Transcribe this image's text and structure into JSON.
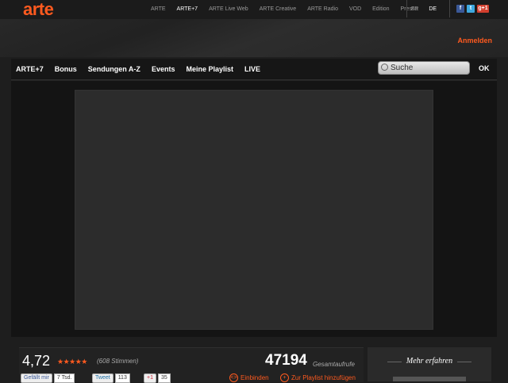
{
  "brand": {
    "logo": "arte"
  },
  "topnav": [
    "ARTE",
    "ARTE+7",
    "ARTE Live Web",
    "ARTE Creative",
    "ARTE Radio",
    "VOD",
    "Edition",
    "Presse"
  ],
  "topnav_active": "ARTE+7",
  "lang": {
    "fr": "FR",
    "de": "DE"
  },
  "social": {
    "facebook": "f",
    "twitter": "t",
    "google": "g+1"
  },
  "login": "Anmelden",
  "mainnav": [
    "ARTE+7",
    "Bonus",
    "Sendungen A-Z",
    "Events",
    "Meine Playlist",
    "LIVE"
  ],
  "search": {
    "value": "Suche",
    "button": "OK"
  },
  "rating": {
    "value": "4,72",
    "stars": "★★★★★",
    "votes": "(608 Stimmen)"
  },
  "views": {
    "count": "47194",
    "label": "Gesamtaufrufe"
  },
  "share": {
    "fb_label": "Gefällt mir",
    "fb_count": "7 Tsd.",
    "tw_label": "Tweet",
    "tw_count": "113",
    "gp_label": "+1",
    "gp_count": "35"
  },
  "actions": {
    "embed": "Einbinden",
    "playlist": "Zur Playlist hinzufügen"
  },
  "sidebar": {
    "title": "Mehr erfahren"
  },
  "colors": {
    "accent": "#ff5a1f",
    "background": "#1e1e1e"
  }
}
